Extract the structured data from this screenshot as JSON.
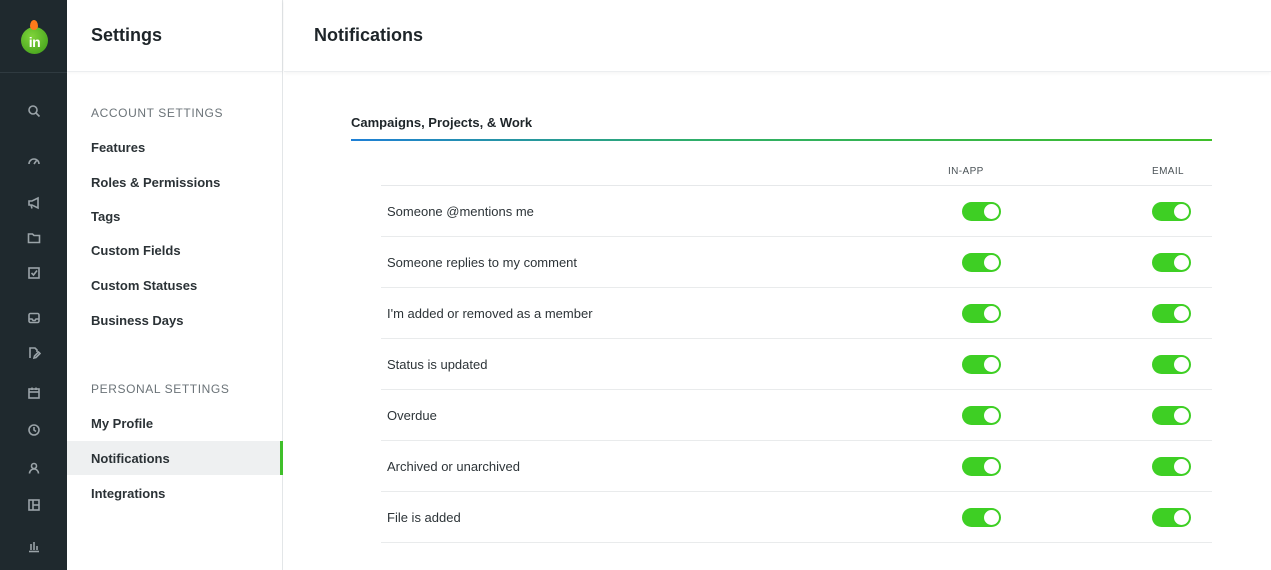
{
  "app": {
    "logo_text": "in"
  },
  "rail_icons": [
    "search-icon",
    "dashboard-icon",
    "megaphone-icon",
    "folder-icon",
    "checkbox-icon",
    "inbox-icon",
    "document-edit-icon",
    "calendar-icon",
    "clock-icon",
    "user-icon",
    "layout-icon",
    "bar-chart-icon"
  ],
  "sidebar": {
    "title": "Settings",
    "account_label": "ACCOUNT SETTINGS",
    "account_items": [
      "Features",
      "Roles & Permissions",
      "Tags",
      "Custom Fields",
      "Custom Statuses",
      "Business Days"
    ],
    "personal_label": "PERSONAL SETTINGS",
    "personal_items": [
      "My Profile",
      "Notifications",
      "Integrations"
    ],
    "active_item": "Notifications"
  },
  "main": {
    "title": "Notifications",
    "section_title": "Campaigns, Projects, & Work",
    "columns": {
      "in_app": "IN-APP",
      "email": "EMAIL"
    },
    "rows": [
      {
        "label": "Someone @mentions me",
        "in_app": true,
        "email": true
      },
      {
        "label": "Someone replies to my comment",
        "in_app": true,
        "email": true
      },
      {
        "label": "I'm added or removed as a member",
        "in_app": true,
        "email": true
      },
      {
        "label": "Status is updated",
        "in_app": true,
        "email": true
      },
      {
        "label": "Overdue",
        "in_app": true,
        "email": true
      },
      {
        "label": "Archived or unarchived",
        "in_app": true,
        "email": true
      },
      {
        "label": "File is added",
        "in_app": true,
        "email": true
      }
    ]
  },
  "colors": {
    "accent": "#3fbf2a",
    "toggle_on": "#3ecf24",
    "rail_bg": "#1f292e"
  }
}
